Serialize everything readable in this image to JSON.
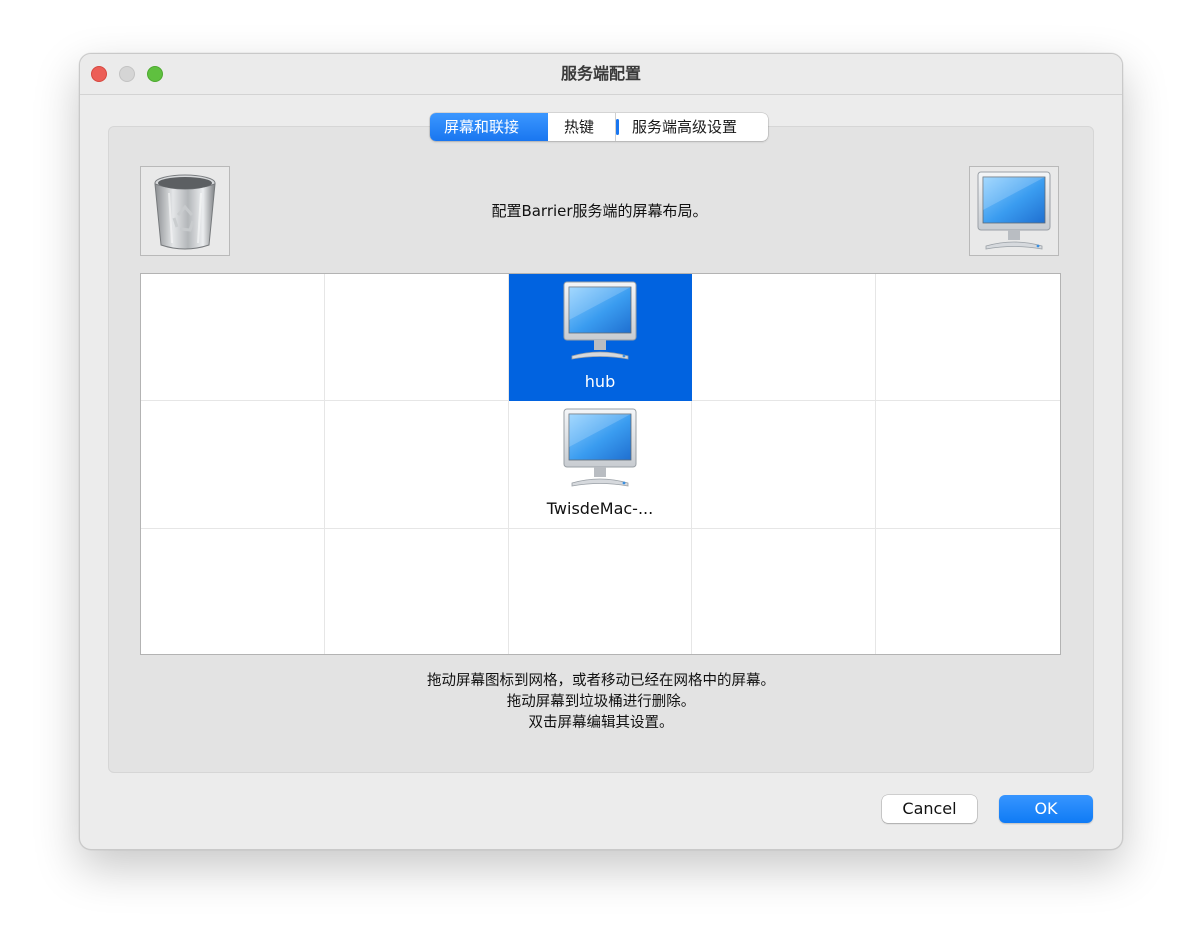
{
  "window": {
    "title": "服务端配置"
  },
  "tabs": [
    {
      "label": "屏幕和联接",
      "active": true
    },
    {
      "label": "热键",
      "active": false
    },
    {
      "label": "服务端高级设置",
      "active": false
    }
  ],
  "description": "配置Barrier服务端的屏幕布局。",
  "icons": {
    "trash": "trash-icon",
    "new_screen": "monitor-icon"
  },
  "grid": {
    "columns": 5,
    "rows": 3,
    "screens": [
      {
        "name": "hub",
        "row": 0,
        "col": 2,
        "selected": true
      },
      {
        "name": "TwisdeMac-...",
        "row": 1,
        "col": 2,
        "selected": false
      }
    ]
  },
  "instructions": [
    "拖动屏幕图标到网格，或者移动已经在网格中的屏幕。",
    "拖动屏幕到垃圾桶进行删除。",
    "双击屏幕编辑其设置。"
  ],
  "buttons": {
    "cancel": "Cancel",
    "ok": "OK"
  },
  "colors": {
    "accent": "#1976f0",
    "selected_cell": "#0163e0"
  }
}
